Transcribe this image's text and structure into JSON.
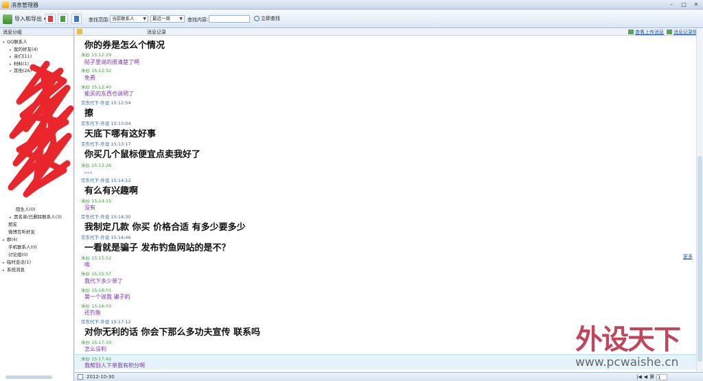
{
  "window": {
    "title": "消息管理器",
    "controls": [
      "–",
      "□",
      "✕"
    ]
  },
  "toolbar": {
    "import_export": "导入和导出",
    "scope_label": "查找范围:",
    "scope_value": "当前联系人",
    "period_value": "最近一周",
    "content_label": "查找内容:",
    "search_button": "立即查找"
  },
  "sidebar": {
    "header": "消息分组",
    "items": [
      {
        "label": "QQ联系人",
        "expand": "▾"
      },
      {
        "label": "我的好友(4)",
        "expand": "▸"
      },
      {
        "label": "亲们(11)",
        "expand": "▸"
      },
      {
        "label": "材料(1)",
        "expand": "▸"
      },
      {
        "label": "其他(26)",
        "expand": "▾"
      },
      {
        "label": "陌生人(0)",
        "expand": ""
      },
      {
        "label": "黑名单/已删除联系人(3)",
        "expand": "▸"
      },
      {
        "label": "朋友",
        "expand": ""
      },
      {
        "label": "微博互听好友",
        "expand": ""
      },
      {
        "label": "群(4)",
        "expand": "▸"
      },
      {
        "label": "手机联系人(0)",
        "expand": ""
      },
      {
        "label": "讨论组(0)",
        "expand": ""
      },
      {
        "label": "临时会话(1)",
        "expand": "▸"
      },
      {
        "label": "系统消息",
        "expand": "▸"
      }
    ]
  },
  "main": {
    "header_title": "消息记录",
    "link_upload": "查看上传消息",
    "link_recover": "消息记录恢复",
    "side_link": "更多",
    "messages": [
      {
        "sender": "",
        "time": "",
        "text": "你的券是怎么个情况",
        "who": "peer",
        "big": true
      },
      {
        "sender": "米纱",
        "time": "15:12:29",
        "text": "帖子里说的很清楚了啊",
        "who": "me",
        "big": false
      },
      {
        "sender": "米纱",
        "time": "15:12:32",
        "text": "免费",
        "who": "me",
        "big": false
      },
      {
        "sender": "米纱",
        "time": "15:12:40",
        "text": "能买的东西也说明了",
        "who": "me",
        "big": false
      },
      {
        "sender": "京东代下-外设",
        "time": "15:12:54",
        "text": "擦",
        "who": "peer",
        "big": true
      },
      {
        "sender": "京东代下-外设",
        "time": "15:13:04",
        "text": "天底下哪有这好事",
        "who": "peer",
        "big": true
      },
      {
        "sender": "京东代下-外设",
        "time": "15:13:17",
        "text": "你买几个鼠标便宜点卖我好了",
        "who": "peer",
        "big": true
      },
      {
        "sender": "米纱",
        "time": "15:13:26",
        "text": "。。。",
        "who": "me",
        "big": false
      },
      {
        "sender": "京东代下-外设",
        "time": "15:14:12",
        "text": "有么有兴趣啊",
        "who": "peer",
        "big": true
      },
      {
        "sender": "米纱",
        "time": "15:14:15",
        "text": "没有",
        "who": "me",
        "big": false
      },
      {
        "sender": "京东代下-外设",
        "time": "15:14:30",
        "text": "我制定几款 你买 价格合适 有多少要多少",
        "who": "peer",
        "big": true
      },
      {
        "sender": "京东代下-外设",
        "time": "15:14:46",
        "text": "一看就是骗子 发布钓鱼网站的是不？",
        "who": "peer",
        "big": true
      },
      {
        "sender": "米纱",
        "time": "15:15:52",
        "text": "唉",
        "who": "me",
        "big": false
      },
      {
        "sender": "米纱",
        "time": "15:15:57",
        "text": "我代下多少单了",
        "who": "me",
        "big": false
      },
      {
        "sender": "米纱",
        "time": "15:16:01",
        "text": "第一个说我 骗子的",
        "who": "me",
        "big": false
      },
      {
        "sender": "米纱",
        "time": "15:16:03",
        "text": "还钓鱼",
        "who": "me",
        "big": false
      },
      {
        "sender": "京东代下-外设",
        "time": "15:17:12",
        "text": "对你无利的话 你会下那么多功夫宣传 联系吗",
        "who": "peer",
        "big": true
      },
      {
        "sender": "米纱",
        "time": "15:17:33",
        "text": "怎么没利",
        "who": "me",
        "big": false
      },
      {
        "sender": "米纱",
        "time": "15:17:42",
        "text": "我帮别人下单我有积分啊",
        "who": "me",
        "big": false
      }
    ]
  },
  "statusbar": {
    "date": "2012-10-30",
    "page_prefix": "第",
    "page_value": "1"
  },
  "watermark": {
    "cn": "外设天下",
    "url": "www.pcwaishe.cn"
  }
}
